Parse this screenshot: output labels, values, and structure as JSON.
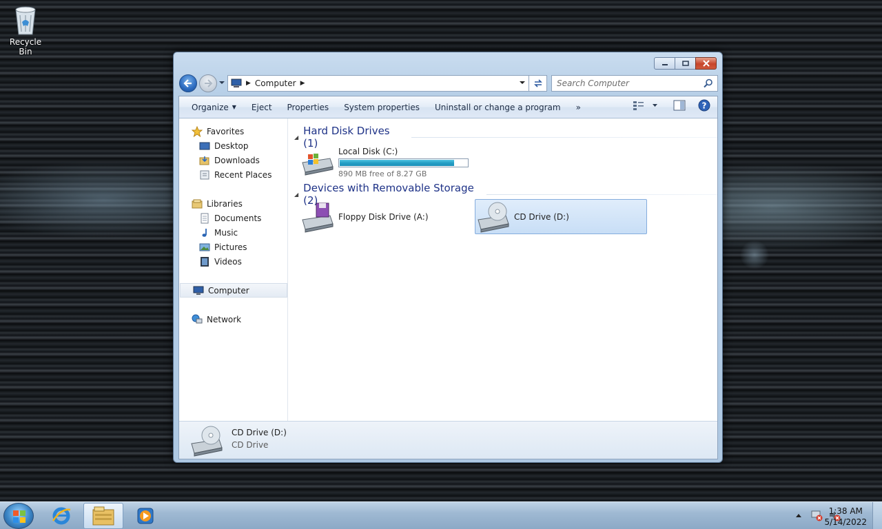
{
  "desktop": {
    "icons": [
      {
        "label": "Recycle Bin",
        "icon": "recycle-bin-icon"
      }
    ]
  },
  "window": {
    "nav": {
      "breadcrumb": [
        "Computer"
      ],
      "search_placeholder": "Search Computer"
    },
    "toolbar": {
      "items": [
        "Organize",
        "Eject",
        "Properties",
        "System properties",
        "Uninstall or change a program"
      ],
      "more": "»"
    },
    "navpane": {
      "favorites": {
        "label": "Favorites",
        "items": [
          "Desktop",
          "Downloads",
          "Recent Places"
        ]
      },
      "libraries": {
        "label": "Libraries",
        "items": [
          "Documents",
          "Music",
          "Pictures",
          "Videos"
        ]
      },
      "computer": "Computer",
      "network": "Network"
    },
    "content": {
      "groups": [
        {
          "title": "Hard Disk Drives (1)"
        },
        {
          "title": "Devices with Removable Storage (2)"
        }
      ],
      "local_disk": {
        "name": "Local Disk (C:)",
        "free_text": "890 MB free of 8.27 GB",
        "used_fraction": 0.895
      },
      "floppy": {
        "name": "Floppy Disk Drive (A:)"
      },
      "cd": {
        "name": "CD Drive (D:)"
      }
    },
    "details": {
      "name": "CD Drive (D:)",
      "type": "CD Drive"
    }
  },
  "taskbar": {
    "apps": [
      "start-orb",
      "internet-explorer-icon",
      "windows-explorer-icon",
      "media-player-icon"
    ],
    "time": "1:38 AM",
    "date": "5/14/2022"
  },
  "colors": {
    "accent_title": "#1e3287",
    "capacity_fill": "#25a0c6",
    "selection": "#c8def6"
  }
}
